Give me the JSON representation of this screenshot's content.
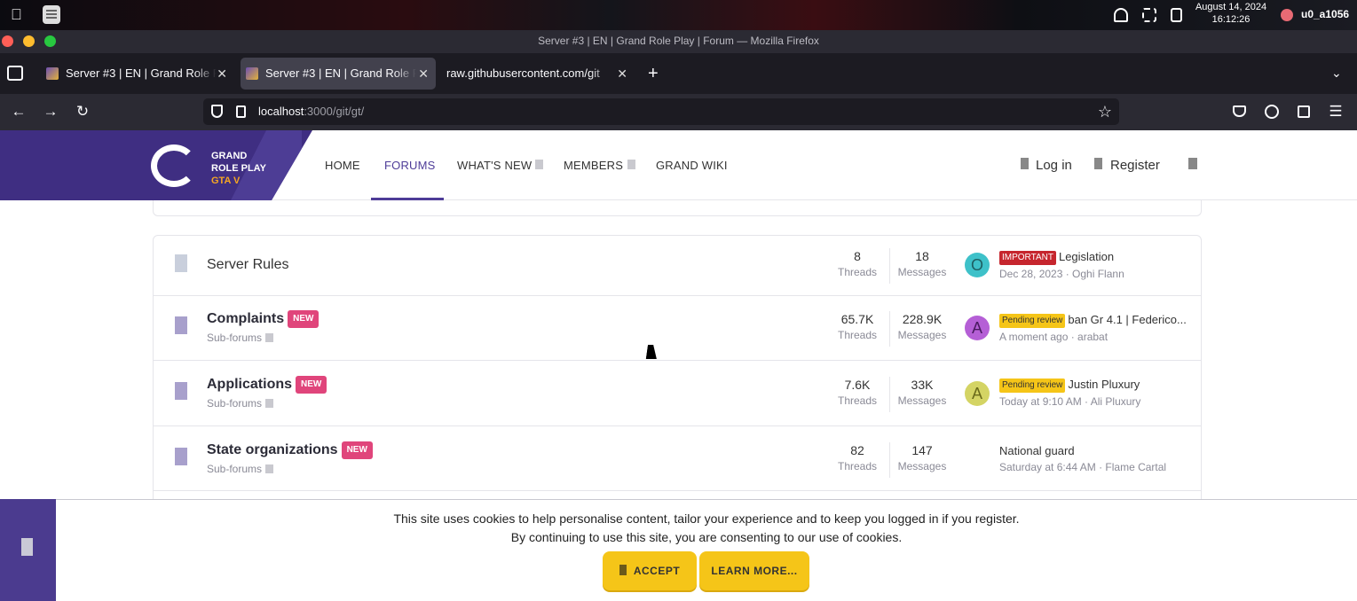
{
  "os": {
    "date": "August 14, 2024",
    "time": "16:12:26",
    "user": "u0_a1056"
  },
  "window": {
    "title": "Server #3 | EN | Grand Role Play | Forum — Mozilla Firefox"
  },
  "tabs": [
    {
      "label": "Server #3 | EN | Grand Role Play | Forum"
    },
    {
      "label": "Server #3 | EN | Grand Role Play | Forum"
    },
    {
      "label": "raw.githubusercontent.com/git"
    }
  ],
  "urlbar": {
    "host": "localhost",
    "path": ":3000/git/gt/"
  },
  "logo": {
    "line1": "GRAND",
    "line2": "ROLE PLAY",
    "line3": "GTA V"
  },
  "nav": {
    "home": "HOME",
    "forums": "FORUMS",
    "whats_new": "WHAT'S NEW",
    "members": "MEMBERS",
    "wiki": "GRAND WIKI",
    "login": "Log in",
    "register": "Register"
  },
  "forums": [
    {
      "title": "Server Rules",
      "threads": "8",
      "messages": "18",
      "avatar": "O",
      "badge": "IMPORTANT",
      "last_title": "Legislation",
      "last_meta": "Dec 28, 2023 · Oghi Flann"
    },
    {
      "title": "Complaints",
      "new": "NEW",
      "sub": "Sub-forums",
      "threads": "65.7K",
      "messages": "228.9K",
      "avatar": "A",
      "badge": "Pending review",
      "last_title": "ban Gr 4.1 | Federico...",
      "last_meta": "A moment ago · arabat"
    },
    {
      "title": "Applications",
      "new": "NEW",
      "sub": "Sub-forums",
      "threads": "7.6K",
      "messages": "33K",
      "avatar": "A",
      "badge": "Pending review",
      "last_title": "Justin Pluxury",
      "last_meta": "Today at 9:10 AM · Ali Pluxury"
    },
    {
      "title": "State organizations",
      "new": "NEW",
      "sub": "Sub-forums",
      "threads": "82",
      "messages": "147",
      "last_title": "National guard",
      "last_meta": "Saturday at 6:44 AM · Flame Cartal"
    }
  ],
  "labels": {
    "threads": "Threads",
    "messages": "Messages"
  },
  "cookie": {
    "line1": "This site uses cookies to help personalise content, tailor your experience and to keep you logged in if you register.",
    "line2": "By continuing to use this site, you are consenting to our use of cookies.",
    "accept": "ACCEPT",
    "learn_more": "LEARN MORE..."
  },
  "colors": {
    "brand": "#3f2e82",
    "accent": "#f5c518",
    "new_badge": "#e0457b",
    "important": "#c6262e"
  }
}
